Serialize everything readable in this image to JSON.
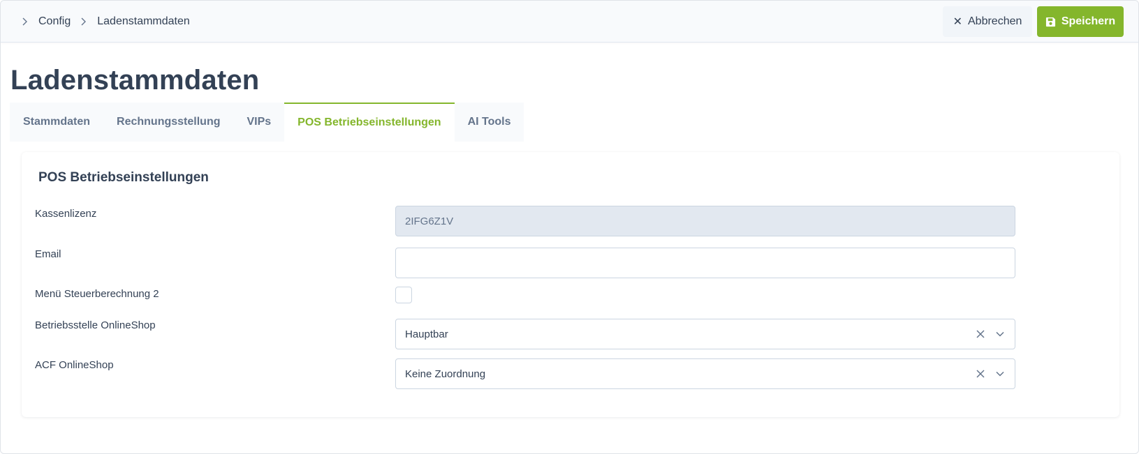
{
  "breadcrumb": {
    "items": [
      "Config",
      "Ladenstammdaten"
    ]
  },
  "toolbar": {
    "cancel_label": "Abbrechen",
    "save_label": "Speichern"
  },
  "page": {
    "title": "Ladenstammdaten"
  },
  "tabs": [
    {
      "label": "Stammdaten",
      "active": false
    },
    {
      "label": "Rechnungsstellung",
      "active": false
    },
    {
      "label": "VIPs",
      "active": false
    },
    {
      "label": "POS Betriebseinstellungen",
      "active": true
    },
    {
      "label": "AI Tools",
      "active": false
    }
  ],
  "card": {
    "title": "POS Betriebseinstellungen",
    "fields": {
      "kassenlizenz": {
        "label": "Kassenlizenz",
        "value": "2IFG6Z1V"
      },
      "email": {
        "label": "Email",
        "value": ""
      },
      "menu_steuer": {
        "label": "Menü Steuerberechnung 2",
        "checked": false
      },
      "betriebsstelle": {
        "label": "Betriebsstelle OnlineShop",
        "value": "Hauptbar"
      },
      "acf": {
        "label": "ACF OnlineShop",
        "value": "Keine Zuordnung"
      }
    }
  },
  "colors": {
    "accent": "#84b62c",
    "text": "#334155",
    "muted": "#64748b"
  }
}
